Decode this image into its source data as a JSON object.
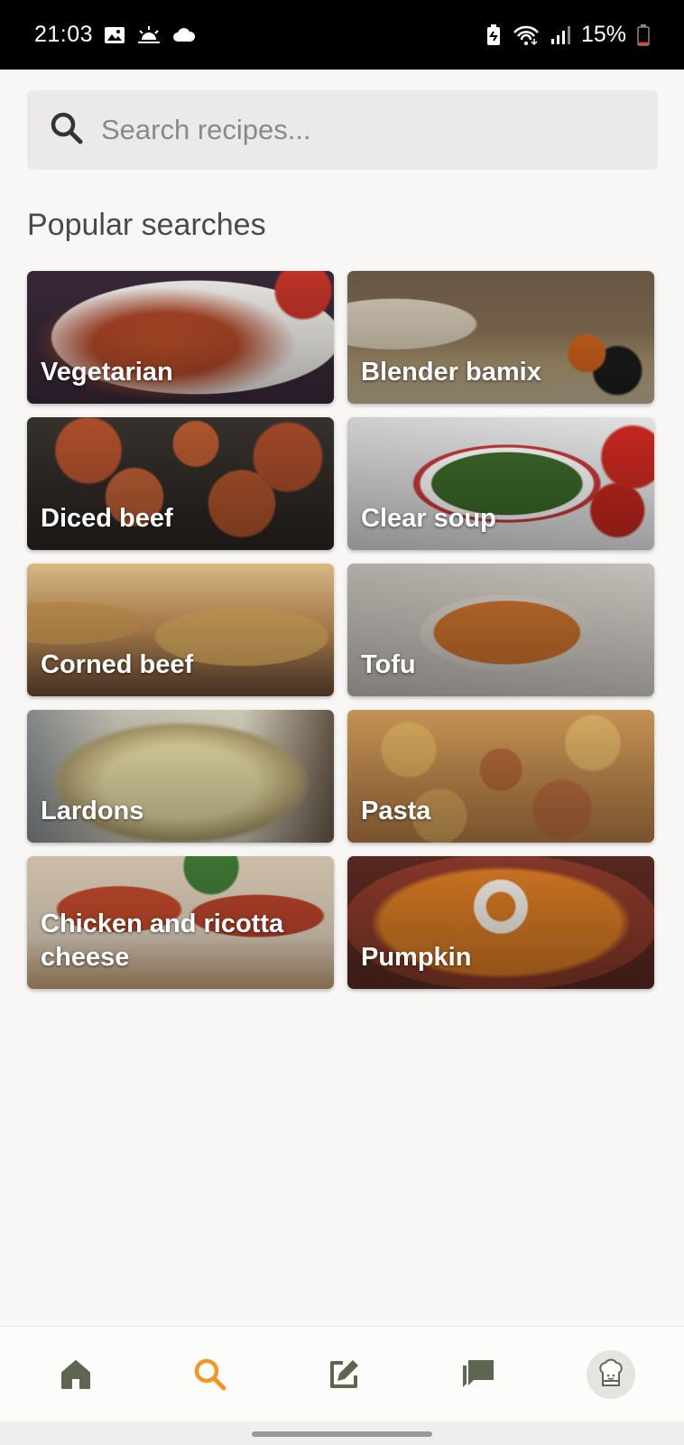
{
  "status_bar": {
    "time": "21:03",
    "battery_percent": "15%",
    "icons_left": [
      "gallery-icon",
      "sunrise-icon",
      "cloud-icon"
    ],
    "icons_right": [
      "battery-saver-icon",
      "wifi-icon",
      "signal-icon",
      "battery-icon"
    ],
    "battery_level": 0.15,
    "battery_color": "#e5432c"
  },
  "search": {
    "placeholder": "Search recipes...",
    "value": ""
  },
  "popular": {
    "title": "Popular searches",
    "items": [
      {
        "label": "Vegetarian"
      },
      {
        "label": "Blender bamix"
      },
      {
        "label": "Diced beef"
      },
      {
        "label": "Clear soup"
      },
      {
        "label": "Corned beef"
      },
      {
        "label": "Tofu"
      },
      {
        "label": "Lardons"
      },
      {
        "label": "Pasta"
      },
      {
        "label": "Chicken and ricotta cheese"
      },
      {
        "label": "Pumpkin"
      }
    ]
  },
  "bottom_nav": {
    "items": [
      {
        "icon": "home-icon",
        "active": false
      },
      {
        "icon": "search-icon",
        "active": true
      },
      {
        "icon": "edit-icon",
        "active": false
      },
      {
        "icon": "chat-icon",
        "active": false
      },
      {
        "icon": "chef-avatar-icon",
        "active": false
      }
    ],
    "active_color": "#f2962b",
    "inactive_color": "#5e6651"
  }
}
